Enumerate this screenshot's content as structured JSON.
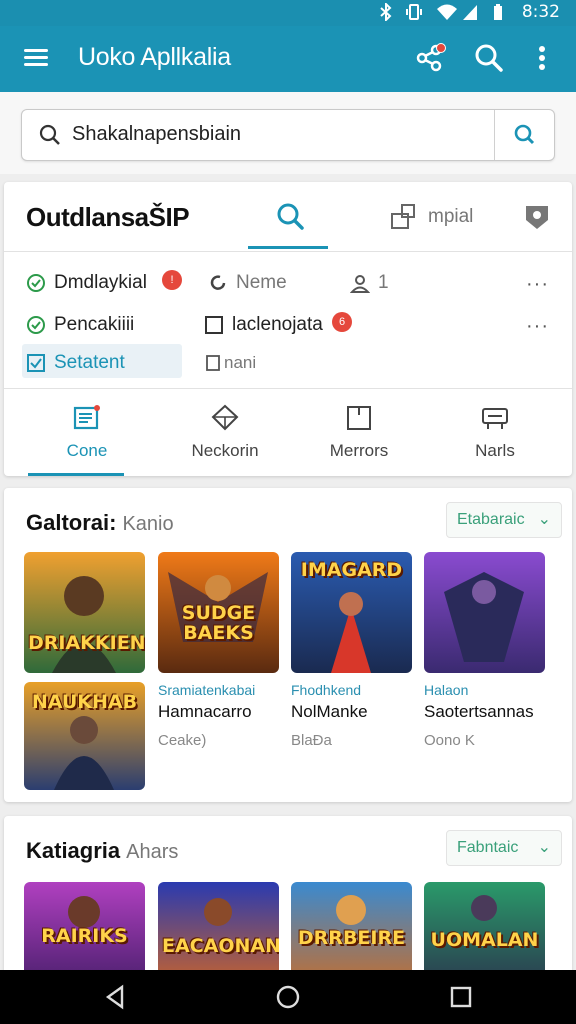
{
  "status": {
    "time": "8:32"
  },
  "appbar": {
    "title": "Uoko Apllkalia",
    "menu_icon": "menu-icon",
    "share_icon": "share-icon",
    "search_icon": "search-icon",
    "more_icon": "more-vert-icon"
  },
  "search": {
    "value": "Shakalnapensbiain"
  },
  "filter": {
    "title": "OutdlansaŠIP",
    "tab_label": "mpial",
    "options": [
      {
        "label": "Dmdlaykial",
        "badge": "!"
      },
      {
        "label": "Neme"
      },
      {
        "label": "1"
      },
      {
        "label": "Pencakiiii"
      },
      {
        "label": "laclenojata",
        "badge": "6"
      },
      {
        "label": "Setatent"
      },
      {
        "label": "nani"
      }
    ],
    "nav": [
      {
        "label": "Cone",
        "active": true
      },
      {
        "label": "Neckorin"
      },
      {
        "label": "Merrors"
      },
      {
        "label": "Narls"
      }
    ]
  },
  "section1": {
    "title": "Galtorai:",
    "subtitle": "Kanio",
    "dropdown": "Etabaraic",
    "thumbs": [
      {
        "title": "DRIAKKIEN",
        "colors": [
          "#f0a030",
          "#2f6a3a"
        ]
      },
      {
        "title": "SUDGE BAEKS",
        "colors": [
          "#f07a18",
          "#5a2a10"
        ]
      },
      {
        "title": "IMAGARD",
        "colors": [
          "#2a5bb0",
          "#d8372a"
        ]
      },
      {
        "title": "",
        "colors": [
          "#8a4bd0",
          "#3a2a70"
        ]
      },
      {
        "title": "NAUKHAB",
        "colors": [
          "#e8a028",
          "#2b3e70"
        ]
      }
    ],
    "cards": [
      {
        "category": "Sramiatenkabai",
        "name": "Hamnacarro",
        "meta": "Ceake)"
      },
      {
        "category": "Fhodhkend",
        "name": "NolManke",
        "meta": "BlaÐa"
      },
      {
        "category": "Halaon",
        "name": "Saotertsannas",
        "meta": "Oono K"
      }
    ]
  },
  "section2": {
    "title": "Katiagria",
    "subtitle": "Ahars",
    "dropdown": "Fabntaic",
    "thumbs": [
      {
        "title": "RAIRIKS",
        "colors": [
          "#b040c0",
          "#3a1a60"
        ]
      },
      {
        "title": "EACAONAN",
        "colors": [
          "#2a3ab0",
          "#e06a18"
        ]
      },
      {
        "title": "DRRBEIRE",
        "colors": [
          "#3a8ad0",
          "#d86a18"
        ]
      },
      {
        "title": "UOMALAN",
        "colors": [
          "#2a9a6a",
          "#2a2a4a"
        ]
      }
    ]
  }
}
